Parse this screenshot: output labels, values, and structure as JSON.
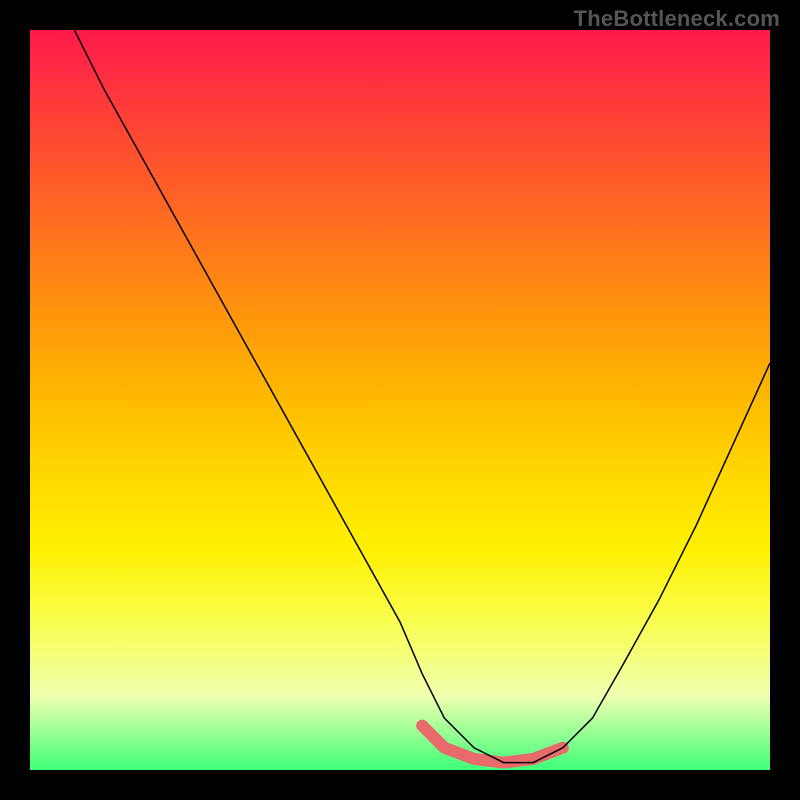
{
  "watermark": "TheBottleneck.com",
  "chart_data": {
    "type": "line",
    "title": "",
    "xlabel": "",
    "ylabel": "",
    "xlim": [
      0,
      100
    ],
    "ylim": [
      0,
      100
    ],
    "grid": false,
    "series": [
      {
        "name": "bottleneck-curve",
        "x": [
          6,
          10,
          15,
          20,
          25,
          30,
          35,
          40,
          45,
          50,
          53,
          56,
          60,
          64,
          68,
          72,
          76,
          80,
          85,
          90,
          95,
          100
        ],
        "y": [
          100,
          92,
          83,
          74,
          65,
          56,
          47,
          38,
          29,
          20,
          13,
          7,
          3,
          1,
          1,
          3,
          7,
          14,
          23,
          33,
          44,
          55
        ]
      }
    ],
    "annotations": [
      {
        "name": "optimal-band",
        "x": [
          53,
          56,
          60,
          64,
          68,
          72
        ],
        "y": [
          6,
          3,
          1.5,
          1,
          1.5,
          3
        ]
      }
    ],
    "colors": {
      "gradient_top": "#ff1a4b",
      "gradient_bottom": "#3fff7a",
      "curve": "#000000",
      "optimal": "#e86a6a",
      "frame": "#000000"
    }
  }
}
